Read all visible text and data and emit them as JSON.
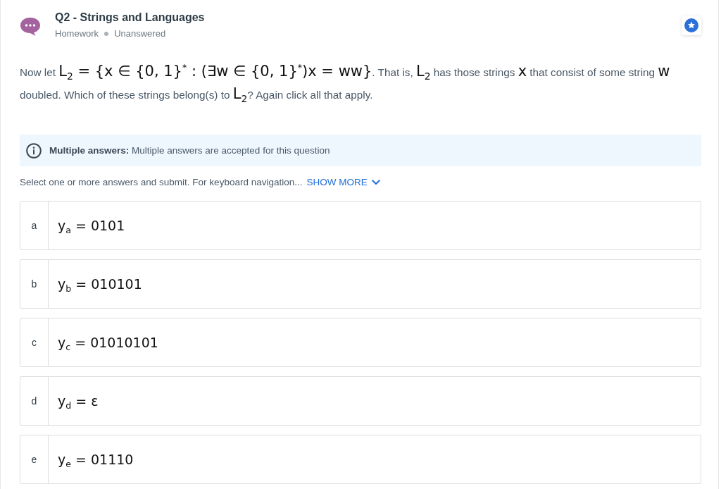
{
  "header": {
    "title": "Q2 - Strings and Languages",
    "meta": [
      "Homework",
      "Unanswered"
    ]
  },
  "question": [
    {
      "kind": "text",
      "text": "Now let "
    },
    {
      "kind": "math",
      "text": "L$_{2}$ = {x ∈ {0, 1}$^{*}$ : (∃w ∈ {0, 1}$^{*}$)x = ww}"
    },
    {
      "kind": "text",
      "text": ". That is, "
    },
    {
      "kind": "math",
      "text": "L$_{2}$"
    },
    {
      "kind": "text",
      "text": " has those strings "
    },
    {
      "kind": "math",
      "text": "x"
    },
    {
      "kind": "text",
      "text": " that consist of some string "
    },
    {
      "kind": "math",
      "text": "w"
    },
    {
      "kind": "text",
      "text": " doubled. Which of these strings belong(s) to "
    },
    {
      "kind": "math",
      "text": "L$_{2}$"
    },
    {
      "kind": "text",
      "text": "? Again click all that apply."
    }
  ],
  "notice": {
    "text": "**Multiple answers:** Multiple answers are accepted for this question"
  },
  "instruction": {
    "text": "Select one or more answers and submit. For keyboard navigation...",
    "link": "SHOW MORE"
  },
  "options": [
    {
      "letter": "a",
      "text": "y$_{a}$ = 0101",
      "selected": false
    },
    {
      "letter": "b",
      "text": "y$_{b}$ = 010101",
      "selected": false
    },
    {
      "letter": "c",
      "text": "y$_{c}$ = 01010101",
      "selected": false
    },
    {
      "letter": "d",
      "text": "y$_{d}$ = ε",
      "selected": false
    },
    {
      "letter": "e",
      "text": "y$_{e}$ = 01110",
      "selected": false
    }
  ]
}
